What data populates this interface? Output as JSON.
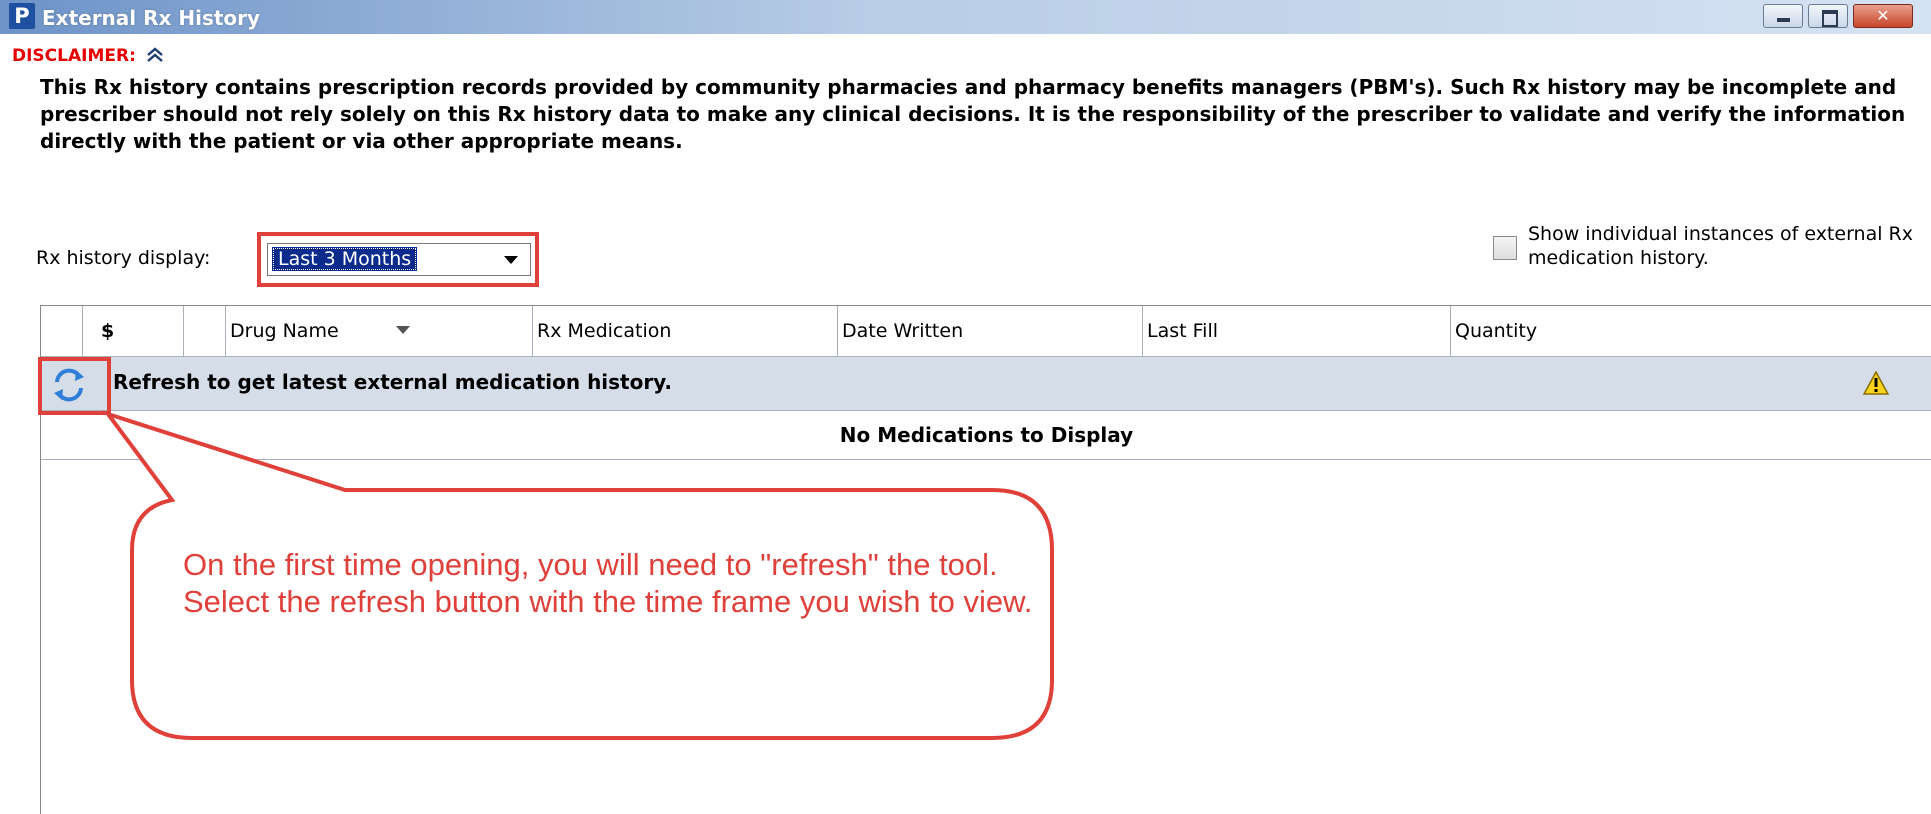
{
  "window": {
    "app_icon_letter": "P",
    "title": "External Rx History"
  },
  "disclaimer": {
    "heading": "DISCLAIMER:",
    "collapse_glyph": "⬆",
    "text": "This Rx history contains prescription records provided by community pharmacies and pharmacy benefits managers (PBM's). Such Rx history may be incomplete and prescriber should not rely solely on this Rx history data to make any clinical decisions. It is the responsibility of the prescriber to validate and verify the information directly with the patient or via other appropriate means."
  },
  "display": {
    "label": "Rx history display:",
    "selected": "Last 3 Months"
  },
  "show_individual": {
    "checked": false,
    "label": "Show individual instances of external Rx medication history."
  },
  "grid": {
    "columns": [
      "",
      "$",
      "",
      "Drug Name",
      "Rx Medication",
      "Date Written",
      "Last Fill",
      "Quantity"
    ],
    "refresh_message": "Refresh to get latest external medication history.",
    "empty_message": "No Medications to Display"
  },
  "callout": {
    "text": "On the first time opening, you will need to \"refresh\" the tool.  Select the refresh button with the time frame you wish to view."
  },
  "colors": {
    "annotation_red": "#e0403a",
    "disclaimer_red": "#e60000",
    "refresh_row_bg": "#d5dde8"
  },
  "icons": {
    "refresh": "refresh-icon",
    "warning": "warning-icon",
    "collapse": "double-chevron-up-icon"
  }
}
